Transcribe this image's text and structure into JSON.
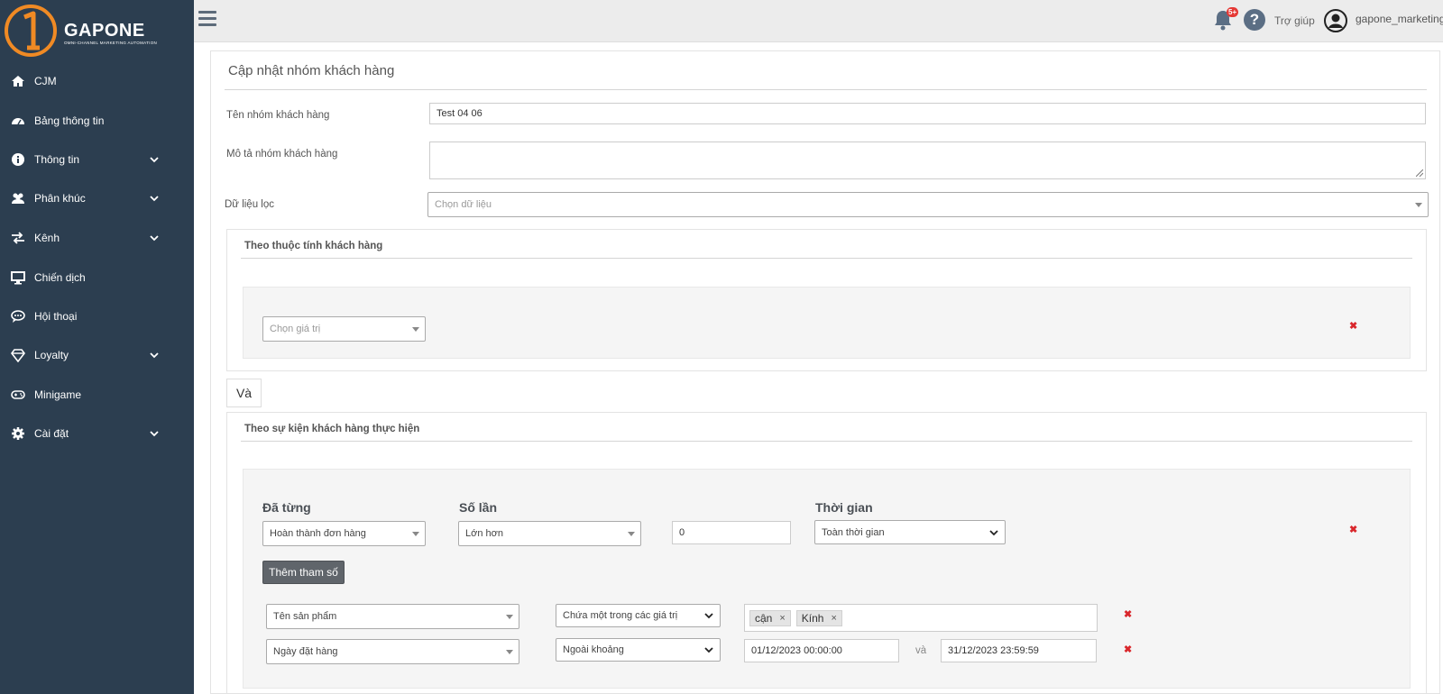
{
  "brand": {
    "name": "GAPONE",
    "tagline": "OMNI-CHANNEL MARKETING AUTOMATION",
    "accent": "#f08a24",
    "sidebar_bg": "#2c3e50"
  },
  "sidebar": {
    "items": [
      {
        "label": "CJM",
        "icon": "home-icon",
        "expandable": false
      },
      {
        "label": "Bảng thông tin",
        "icon": "dashboard-icon",
        "expandable": false
      },
      {
        "label": "Thông tin",
        "icon": "info-icon",
        "expandable": true
      },
      {
        "label": "Phân khúc",
        "icon": "users-icon",
        "expandable": true
      },
      {
        "label": "Kênh",
        "icon": "exchange-icon",
        "expandable": true
      },
      {
        "label": "Chiến dịch",
        "icon": "desktop-icon",
        "expandable": false
      },
      {
        "label": "Hội thoại",
        "icon": "chat-icon",
        "expandable": false
      },
      {
        "label": "Loyalty",
        "icon": "diamond-icon",
        "expandable": true
      },
      {
        "label": "Minigame",
        "icon": "gamepad-icon",
        "expandable": false
      },
      {
        "label": "Cài đặt",
        "icon": "gear-icon",
        "expandable": true
      }
    ]
  },
  "topbar": {
    "notification_badge": "5+",
    "help_label": "Trợ giúp",
    "username": "gapone_marketing"
  },
  "page": {
    "title": "Cập nhật nhóm khách hàng",
    "name_label": "Tên nhóm khách hàng",
    "name_value": "Test 04 06",
    "desc_label": "Mô tả nhóm khách hàng",
    "desc_value": "",
    "filter_label": "Dữ liệu lọc",
    "filter_placeholder": "Chọn dữ liệu"
  },
  "attr_section": {
    "title": "Theo thuộc tính khách hàng",
    "value_placeholder": "Chọn giá trị"
  },
  "and_button": "Và",
  "event_section": {
    "title": "Theo sự kiện khách hàng thực hiện",
    "col_done": "Đã từng",
    "col_count": "Số lần",
    "col_time": "Thời gian",
    "event_value": "Hoàn thành đơn hàng",
    "count_op": "Lớn hơn",
    "count_value": "0",
    "time_value": "Toàn thời gian",
    "add_param": "Thêm tham số",
    "params": [
      {
        "field": "Tên sản phẩm",
        "operator": "Chứa một trong các giá trị",
        "tags": [
          "cận",
          "Kính"
        ]
      },
      {
        "field": "Ngày đặt hàng",
        "operator": "Ngoài khoảng",
        "from": "01/12/2023 00:00:00",
        "joiner": "và",
        "to": "31/12/2023 23:59:59"
      }
    ]
  }
}
